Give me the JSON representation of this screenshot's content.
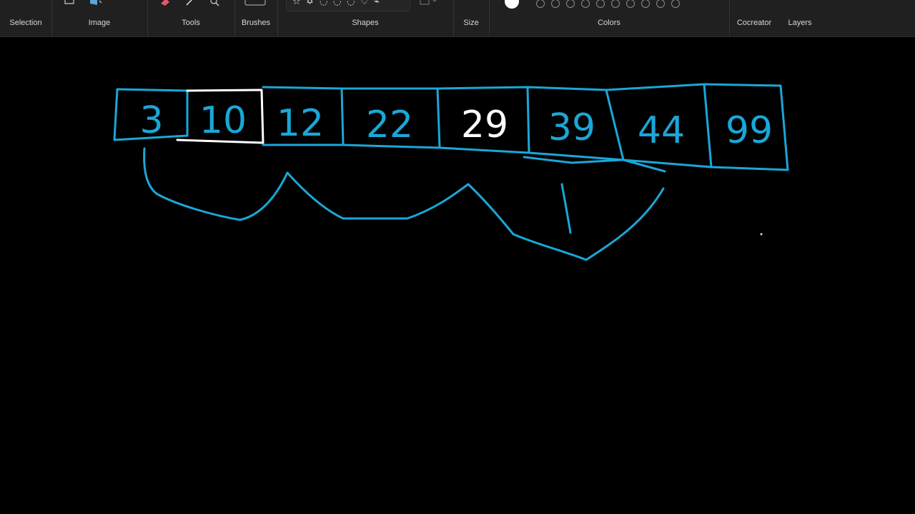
{
  "toolbar": {
    "groups": {
      "selection": "Selection",
      "image": "Image",
      "tools": "Tools",
      "brushes": "Brushes",
      "shapes": "Shapes",
      "size": "Size",
      "colors": "Colors",
      "cocreator": "Cocreator",
      "layers": "Layers"
    },
    "shape_glyphs": [
      "☆",
      "✡",
      "◌",
      "◌",
      "◌",
      "♡",
      "⌁"
    ],
    "active_color": "#ffffff",
    "palette_swatch_count": 10
  },
  "drawing": {
    "numbers": [
      "3",
      "10",
      "12",
      "22",
      "29",
      "39",
      "44",
      "99"
    ],
    "stroke_color": "#1aa7d8",
    "highlight_color": "#ffffff"
  }
}
